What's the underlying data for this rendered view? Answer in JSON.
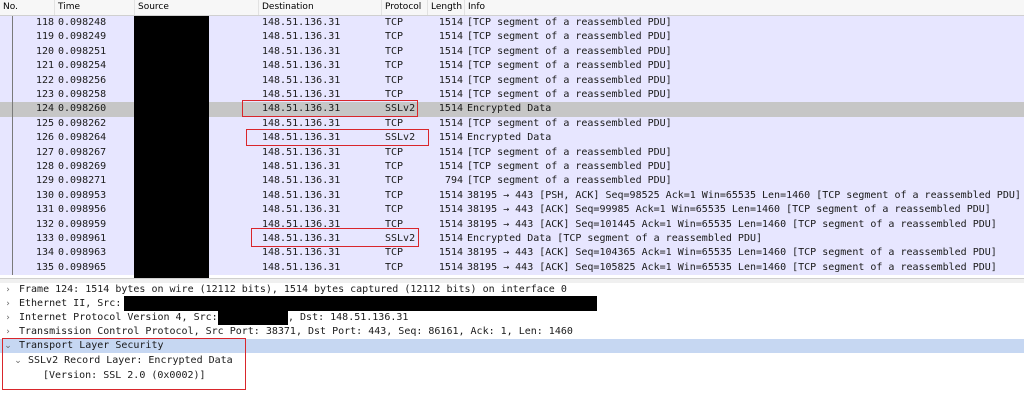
{
  "columns": [
    "No.",
    "Time",
    "Source",
    "Destination",
    "Protocol",
    "Length",
    "Info"
  ],
  "packets": [
    {
      "no": "118",
      "time": "0.098248",
      "dst": "148.51.136.31",
      "proto": "TCP",
      "len": "1514",
      "info": "[TCP segment of a reassembled PDU]"
    },
    {
      "no": "119",
      "time": "0.098249",
      "dst": "148.51.136.31",
      "proto": "TCP",
      "len": "1514",
      "info": "[TCP segment of a reassembled PDU]"
    },
    {
      "no": "120",
      "time": "0.098251",
      "dst": "148.51.136.31",
      "proto": "TCP",
      "len": "1514",
      "info": "[TCP segment of a reassembled PDU]"
    },
    {
      "no": "121",
      "time": "0.098254",
      "dst": "148.51.136.31",
      "proto": "TCP",
      "len": "1514",
      "info": "[TCP segment of a reassembled PDU]"
    },
    {
      "no": "122",
      "time": "0.098256",
      "dst": "148.51.136.31",
      "proto": "TCP",
      "len": "1514",
      "info": "[TCP segment of a reassembled PDU]"
    },
    {
      "no": "123",
      "time": "0.098258",
      "dst": "148.51.136.31",
      "proto": "TCP",
      "len": "1514",
      "info": "[TCP segment of a reassembled PDU]"
    },
    {
      "no": "124",
      "time": "0.098260",
      "dst": "148.51.136.31",
      "proto": "SSLv2",
      "len": "1514",
      "info": "Encrypted Data"
    },
    {
      "no": "125",
      "time": "0.098262",
      "dst": "148.51.136.31",
      "proto": "TCP",
      "len": "1514",
      "info": "[TCP segment of a reassembled PDU]"
    },
    {
      "no": "126",
      "time": "0.098264",
      "dst": "148.51.136.31",
      "proto": "SSLv2",
      "len": "1514",
      "info": "Encrypted Data"
    },
    {
      "no": "127",
      "time": "0.098267",
      "dst": "148.51.136.31",
      "proto": "TCP",
      "len": "1514",
      "info": "[TCP segment of a reassembled PDU]"
    },
    {
      "no": "128",
      "time": "0.098269",
      "dst": "148.51.136.31",
      "proto": "TCP",
      "len": "1514",
      "info": "[TCP segment of a reassembled PDU]"
    },
    {
      "no": "129",
      "time": "0.098271",
      "dst": "148.51.136.31",
      "proto": "TCP",
      "len": "794",
      "info": "[TCP segment of a reassembled PDU]"
    },
    {
      "no": "130",
      "time": "0.098953",
      "dst": "148.51.136.31",
      "proto": "TCP",
      "len": "1514",
      "info": "38195 → 443 [PSH, ACK] Seq=98525 Ack=1 Win=65535 Len=1460 [TCP segment of a reassembled PDU]"
    },
    {
      "no": "131",
      "time": "0.098956",
      "dst": "148.51.136.31",
      "proto": "TCP",
      "len": "1514",
      "info": "38195 → 443 [ACK] Seq=99985 Ack=1 Win=65535 Len=1460 [TCP segment of a reassembled PDU]"
    },
    {
      "no": "132",
      "time": "0.098959",
      "dst": "148.51.136.31",
      "proto": "TCP",
      "len": "1514",
      "info": "38195 → 443 [ACK] Seq=101445 Ack=1 Win=65535 Len=1460 [TCP segment of a reassembled PDU]"
    },
    {
      "no": "133",
      "time": "0.098961",
      "dst": "148.51.136.31",
      "proto": "SSLv2",
      "len": "1514",
      "info": "Encrypted Data [TCP segment of a reassembled PDU]"
    },
    {
      "no": "134",
      "time": "0.098963",
      "dst": "148.51.136.31",
      "proto": "TCP",
      "len": "1514",
      "info": "38195 → 443 [ACK] Seq=104365 Ack=1 Win=65535 Len=1460 [TCP segment of a reassembled PDU]"
    },
    {
      "no": "135",
      "time": "0.098965",
      "dst": "148.51.136.31",
      "proto": "TCP",
      "len": "1514",
      "info": "38195 → 443 [ACK] Seq=105825 Ack=1 Win=65535 Len=1460 [TCP segment of a reassembled PDU]"
    }
  ],
  "details": {
    "frame": "Frame 124: 1514 bytes on wire (12112 bits), 1514 bytes captured (12112 bits) on interface 0",
    "ethernet": "Ethernet II, Src:",
    "ip_prefix": "Internet Protocol Version 4, Src:",
    "ip_dst": ", Dst: 148.51.136.31",
    "tcp": "Transmission Control Protocol, Src Port: 38371, Dst Port: 443, Seq: 86161, Ack: 1, Len: 1460",
    "tls": "Transport Layer Security",
    "record": "SSLv2 Record Layer: Encrypted Data",
    "version": "[Version: SSL 2.0 (0x0002)]"
  },
  "icons": {
    "collapsed": "chevron-right-icon",
    "expanded": "chevron-down-icon"
  },
  "colors": {
    "row_bg": "#e7e6ff",
    "selected_row": "#c6c6c6",
    "highlight": "#d9262b",
    "detail_selected": "#c6d7f2"
  }
}
